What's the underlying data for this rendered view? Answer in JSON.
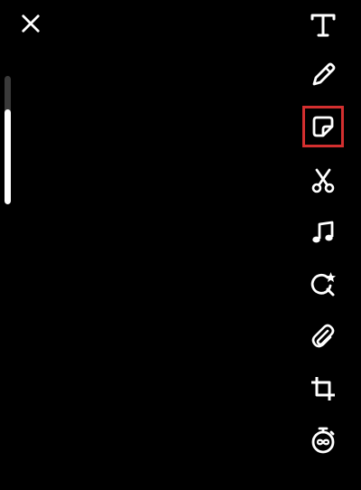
{
  "screen": {
    "background": "#000000",
    "highlight_color": "#d32f2f"
  },
  "close": {
    "icon": "close-icon"
  },
  "brush_size_slider": {
    "level": 0.74
  },
  "toolbar": {
    "tools": [
      {
        "id": "text",
        "icon": "text-icon",
        "highlighted": false
      },
      {
        "id": "draw",
        "icon": "pencil-icon",
        "highlighted": false
      },
      {
        "id": "sticker",
        "icon": "sticker-icon",
        "highlighted": true
      },
      {
        "id": "scissors",
        "icon": "scissors-icon",
        "highlighted": false
      },
      {
        "id": "music",
        "icon": "music-note-icon",
        "highlighted": false
      },
      {
        "id": "lens",
        "icon": "lens-search-icon",
        "highlighted": false
      },
      {
        "id": "attachment",
        "icon": "paperclip-icon",
        "highlighted": false
      },
      {
        "id": "crop",
        "icon": "crop-icon",
        "highlighted": false
      },
      {
        "id": "timer",
        "icon": "timer-infinity-icon",
        "highlighted": false
      }
    ]
  }
}
